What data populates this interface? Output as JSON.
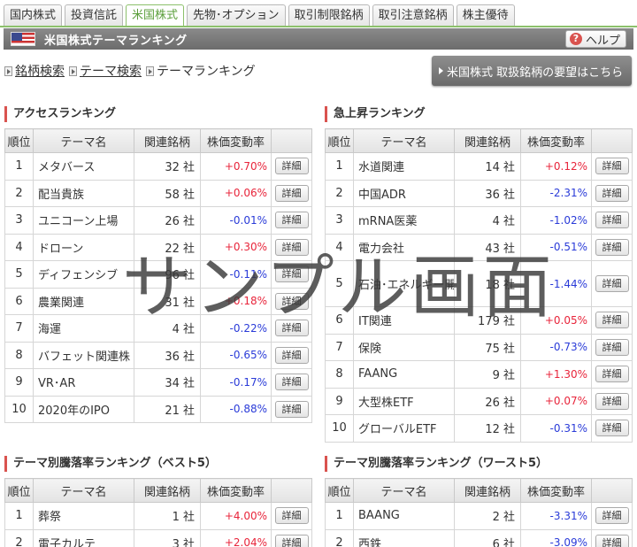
{
  "tabs": [
    "国内株式",
    "投資信託",
    "米国株式",
    "先物･オプション",
    "取引制限銘柄",
    "取引注意銘柄",
    "株主優待"
  ],
  "active_tab": 2,
  "header": {
    "title": "米国株式テーマランキング",
    "help_label": "ヘルプ"
  },
  "breadcrumb": {
    "link1": "銘柄検索",
    "link2": "テーマ検索",
    "current": "テーマランキング"
  },
  "request_button": "米国株式 取扱銘柄の要望はこちら",
  "columns": {
    "rank": "順位",
    "theme": "テーマ名",
    "related": "関連銘柄",
    "change": "株価変動率"
  },
  "detail_label": "詳細",
  "colors": {
    "up": "#e8253b",
    "down": "#2a3bd8",
    "accent": "#d9534f"
  },
  "access_ranking": {
    "title": "アクセスランキング",
    "rows": [
      {
        "rank": "1",
        "name": "メタバース",
        "count": "32 社",
        "change": "+0.70%",
        "dir": "up"
      },
      {
        "rank": "2",
        "name": "配当貴族",
        "count": "58 社",
        "change": "+0.06%",
        "dir": "up"
      },
      {
        "rank": "3",
        "name": "ユニコーン上場",
        "count": "26 社",
        "change": "-0.01%",
        "dir": "down"
      },
      {
        "rank": "4",
        "name": "ドローン",
        "count": "22 社",
        "change": "+0.30%",
        "dir": "up"
      },
      {
        "rank": "5",
        "name": "ディフェンシブ",
        "count": "96 社",
        "change": "-0.11%",
        "dir": "down"
      },
      {
        "rank": "6",
        "name": "農業関連",
        "count": "31 社",
        "change": "+0.18%",
        "dir": "up"
      },
      {
        "rank": "7",
        "name": "海運",
        "count": "4 社",
        "change": "-0.22%",
        "dir": "down"
      },
      {
        "rank": "8",
        "name": "バフェット関連株",
        "count": "36 社",
        "change": "-0.65%",
        "dir": "down"
      },
      {
        "rank": "9",
        "name": "VR･AR",
        "count": "34 社",
        "change": "-0.17%",
        "dir": "down"
      },
      {
        "rank": "10",
        "name": "2020年のIPO",
        "count": "21 社",
        "change": "-0.88%",
        "dir": "down"
      }
    ]
  },
  "surge_ranking": {
    "title": "急上昇ランキング",
    "rows": [
      {
        "rank": "1",
        "name": "水道関連",
        "count": "14 社",
        "change": "+0.12%",
        "dir": "up"
      },
      {
        "rank": "2",
        "name": "中国ADR",
        "count": "36 社",
        "change": "-2.31%",
        "dir": "down"
      },
      {
        "rank": "3",
        "name": "mRNA医薬",
        "count": "4 社",
        "change": "-1.02%",
        "dir": "down"
      },
      {
        "rank": "4",
        "name": "電力会社",
        "count": "43 社",
        "change": "-0.51%",
        "dir": "down"
      },
      {
        "rank": "5",
        "name": "石油･エネルギー開発",
        "count": "18 社",
        "change": "-1.44%",
        "dir": "down"
      },
      {
        "rank": "6",
        "name": "IT関連",
        "count": "179 社",
        "change": "+0.05%",
        "dir": "up"
      },
      {
        "rank": "7",
        "name": "保険",
        "count": "75 社",
        "change": "-0.73%",
        "dir": "down"
      },
      {
        "rank": "8",
        "name": "FAANG",
        "count": "9 社",
        "change": "+1.30%",
        "dir": "up"
      },
      {
        "rank": "9",
        "name": "大型株ETF",
        "count": "26 社",
        "change": "+0.07%",
        "dir": "up"
      },
      {
        "rank": "10",
        "name": "グローバルETF",
        "count": "12 社",
        "change": "-0.31%",
        "dir": "down"
      }
    ]
  },
  "best_ranking": {
    "title": "テーマ別騰落率ランキング（ベスト5）",
    "rows": [
      {
        "rank": "1",
        "name": "葬祭",
        "count": "1 社",
        "change": "+4.00%",
        "dir": "up"
      },
      {
        "rank": "2",
        "name": "電子カルテ",
        "count": "3 社",
        "change": "+2.04%",
        "dir": "up"
      }
    ]
  },
  "worst_ranking": {
    "title": "テーマ別騰落率ランキング（ワースト5）",
    "rows": [
      {
        "rank": "1",
        "name": "BAANG",
        "count": "2 社",
        "change": "-3.31%",
        "dir": "down"
      },
      {
        "rank": "2",
        "name": "西鉄",
        "count": "6 社",
        "change": "-3.09%",
        "dir": "down"
      }
    ]
  },
  "watermark": "サンプル画面"
}
